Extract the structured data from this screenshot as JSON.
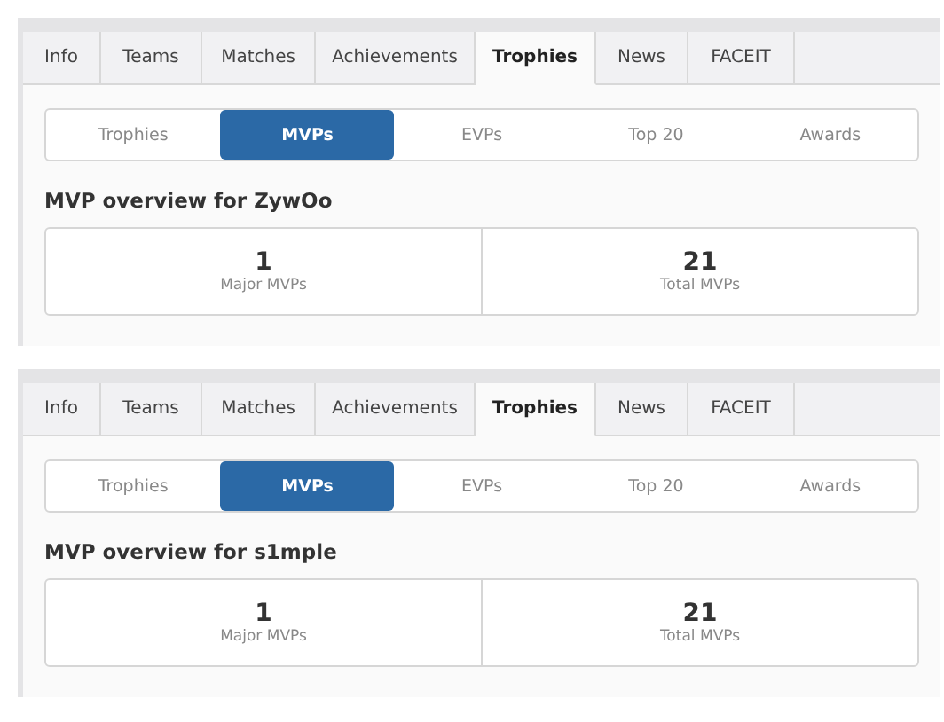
{
  "panels": [
    {
      "tabs": [
        {
          "label": "Info",
          "selected": false
        },
        {
          "label": "Teams",
          "selected": false
        },
        {
          "label": "Matches",
          "selected": false
        },
        {
          "label": "Achievements",
          "selected": false
        },
        {
          "label": "Trophies",
          "selected": true
        },
        {
          "label": "News",
          "selected": false
        },
        {
          "label": "FACEIT",
          "selected": false
        }
      ],
      "subtabs": [
        {
          "label": "Trophies",
          "selected": false
        },
        {
          "label": "MVPs",
          "selected": true
        },
        {
          "label": "EVPs",
          "selected": false
        },
        {
          "label": "Top 20",
          "selected": false
        },
        {
          "label": "Awards",
          "selected": false
        }
      ],
      "heading": "MVP overview for ZywOo",
      "stats": [
        {
          "value": "1",
          "label": "Major MVPs"
        },
        {
          "value": "21",
          "label": "Total MVPs"
        }
      ]
    },
    {
      "tabs": [
        {
          "label": "Info",
          "selected": false
        },
        {
          "label": "Teams",
          "selected": false
        },
        {
          "label": "Matches",
          "selected": false
        },
        {
          "label": "Achievements",
          "selected": false
        },
        {
          "label": "Trophies",
          "selected": true
        },
        {
          "label": "News",
          "selected": false
        },
        {
          "label": "FACEIT",
          "selected": false
        }
      ],
      "subtabs": [
        {
          "label": "Trophies",
          "selected": false
        },
        {
          "label": "MVPs",
          "selected": true
        },
        {
          "label": "EVPs",
          "selected": false
        },
        {
          "label": "Top 20",
          "selected": false
        },
        {
          "label": "Awards",
          "selected": false
        }
      ],
      "heading": "MVP overview for s1mple",
      "stats": [
        {
          "value": "1",
          "label": "Major MVPs"
        },
        {
          "value": "21",
          "label": "Total MVPs"
        }
      ]
    }
  ]
}
